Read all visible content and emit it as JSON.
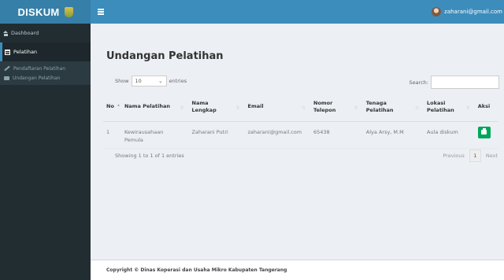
{
  "brand": {
    "logo_text": "DISKUM"
  },
  "header": {
    "user_email": "zaharani@gmail.com"
  },
  "sidebar": {
    "items": [
      {
        "label": "Dashboard"
      },
      {
        "label": "Pelatihan"
      }
    ],
    "sub_items": [
      {
        "label": "Pendaftaran Pelatihan"
      },
      {
        "label": "Undangan Pelatihan"
      }
    ]
  },
  "page": {
    "title": "Undangan Pelatihan",
    "show_label": "Show",
    "entries_label": "entries",
    "page_length": "10",
    "search_label": "Search:",
    "search_value": ""
  },
  "table": {
    "columns": [
      {
        "line1": "No",
        "line2": ""
      },
      {
        "line1": "Nama Pelatihan",
        "line2": ""
      },
      {
        "line1": "Nama",
        "line2": "Lengkap"
      },
      {
        "line1": "Email",
        "line2": ""
      },
      {
        "line1": "Nomor",
        "line2": "Telepon"
      },
      {
        "line1": "Tenaga",
        "line2": "Pelatihan"
      },
      {
        "line1": "Lokasi",
        "line2": "Pelatihan"
      },
      {
        "line1": "Aksi",
        "line2": ""
      }
    ],
    "rows": [
      {
        "no": "1",
        "nama_pelatihan_1": "Kewirausahaan",
        "nama_pelatihan_2": "Pemula",
        "nama_lengkap": "Zaharani Putri",
        "email": "zaharani@gmail.com",
        "telepon": "65438",
        "tenaga": "Alya Arsy, M.M",
        "lokasi": "Aula diskum"
      }
    ]
  },
  "pagination": {
    "info": "Showing 1 to 1 of 1 entries",
    "previous": "Previous",
    "current_page": "1",
    "next": "Next"
  },
  "footer": {
    "text": "Copyright © Dinas Koperasi dan Usaha Mikro Kabupaten Tangerang"
  },
  "colors": {
    "header": "#3c8dbc",
    "logo": "#367fa9",
    "sidebar": "#222d32",
    "action_button": "#00a65a"
  }
}
